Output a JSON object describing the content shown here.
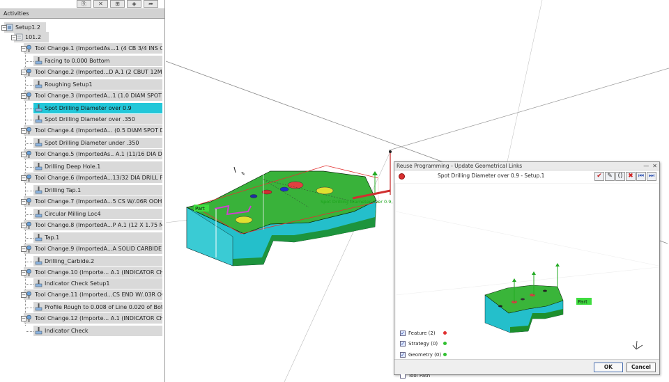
{
  "panel": {
    "header": "Activities",
    "toolbar": [
      "⎘",
      "✕",
      "⊞",
      "◈",
      "➦"
    ]
  },
  "tree": [
    {
      "label": "Setup1.2"
    },
    {
      "label": "101.2"
    },
    {
      "label": "Tool Change.1 (ImportedAs...1 (4 CB 3/4 INS O"
    },
    {
      "label": "Facing to 0.000 Bottom"
    },
    {
      "label": "Tool Change.2 (Imported...D A.1 (2 CBUT 12MM"
    },
    {
      "label": "Roughing Setup1"
    },
    {
      "label": "Tool Change.3 (ImportedA...1 (1.0 DIAM SPOT"
    },
    {
      "label": "Spot Drilling Diameter over 0.9"
    },
    {
      "label": "Spot Drilling Diameter over .350"
    },
    {
      "label": "Tool Change.4 (ImportedA... (0.5 DIAM SPOT D"
    },
    {
      "label": "Spot Drilling Diameter under .350"
    },
    {
      "label": "Tool Change.5 (ImportedAs.. A.1 (11/16 DIA D"
    },
    {
      "label": "Drilling Deep Hole.1"
    },
    {
      "label": "Tool Change.6 (ImportedA...13/32 DIA DRILL F"
    },
    {
      "label": "Drilling Tap.1"
    },
    {
      "label": "Tool Change.7 (ImportedA...5 CS W/.06R OOH"
    },
    {
      "label": "Circular Milling Loc4"
    },
    {
      "label": "Tool Change.8 (ImportedA...P A.1 (12 X 1.75 M"
    },
    {
      "label": "Tap.1"
    },
    {
      "label": "Tool Change.9 (ImportedA...A SOLID CARBIDE"
    },
    {
      "label": "Drilling_Carbide.2"
    },
    {
      "label": "Tool Change.10 (Importe... A.1 (INDICATOR CH"
    },
    {
      "label": "Indicator Check Setup1"
    },
    {
      "label": "Tool Change.11 (Imported...CS END W/.03R OC"
    },
    {
      "label": "Profile Rough to 0.008 of Line 0.020 of Bot"
    },
    {
      "label": "Tool Change.12 (Importe... A.1 (INDICATOR CH"
    },
    {
      "label": "Indicator Check"
    }
  ],
  "viewport": {
    "part_label": "Part",
    "op_label": "Spot Drilling Diameter over 0.9, P.1 Op"
  },
  "dialog": {
    "title": "Reuse Programming - Update Geometrical Links",
    "operation": "Spot Drilling Diameter over 0.9 - Setup.1",
    "part_label": "Part",
    "tools": [
      "✔",
      "✎",
      "()",
      "✖",
      "⏮",
      "⏭"
    ],
    "window_buttons": [
      "—",
      "✕"
    ],
    "checks": [
      {
        "label": "Feature (2)",
        "checked": true,
        "status_color": "#e03030"
      },
      {
        "label": "Strategy (0)",
        "checked": true,
        "status_color": "#30c030"
      },
      {
        "label": "Geometry (0)",
        "checked": true,
        "status_color": "#30c030"
      },
      {
        "label": "Macro (0)",
        "checked": true,
        "status_color": "#30c030"
      },
      {
        "label": "Tool Path",
        "checked": false,
        "status_color": ""
      }
    ],
    "ok_label": "OK",
    "cancel_label": "Cancel"
  },
  "colors": {
    "selection": "#22c7d9",
    "part_top": "#2fb52f",
    "part_side": "#22c2cc",
    "part_bottom": "#1f8a1f"
  }
}
